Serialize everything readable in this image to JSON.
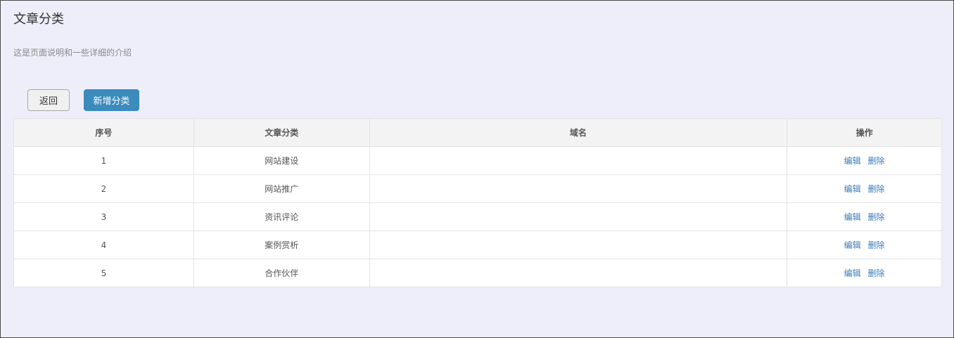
{
  "page": {
    "title": "文章分类",
    "description": "这是页面说明和一些详细的介绍"
  },
  "toolbar": {
    "back_label": "返回",
    "add_label": "新增分类"
  },
  "table": {
    "headers": {
      "index": "序号",
      "category": "文章分类",
      "domain": "域名",
      "actions": "操作"
    },
    "rows": [
      {
        "index": "1",
        "category": "网站建设",
        "domain": "",
        "edit": "编辑",
        "delete": "删除"
      },
      {
        "index": "2",
        "category": "网站推广",
        "domain": "",
        "edit": "编辑",
        "delete": "删除"
      },
      {
        "index": "3",
        "category": "资讯评论",
        "domain": "",
        "edit": "编辑",
        "delete": "删除"
      },
      {
        "index": "4",
        "category": "案例赏析",
        "domain": "",
        "edit": "编辑",
        "delete": "删除"
      },
      {
        "index": "5",
        "category": "合作伙伴",
        "domain": "",
        "edit": "编辑",
        "delete": "删除"
      }
    ]
  },
  "colors": {
    "background": "#eeeefa",
    "primary_button": "#3b8bbd",
    "link": "#3b7ab8",
    "header_bg": "#f3f3f3"
  }
}
